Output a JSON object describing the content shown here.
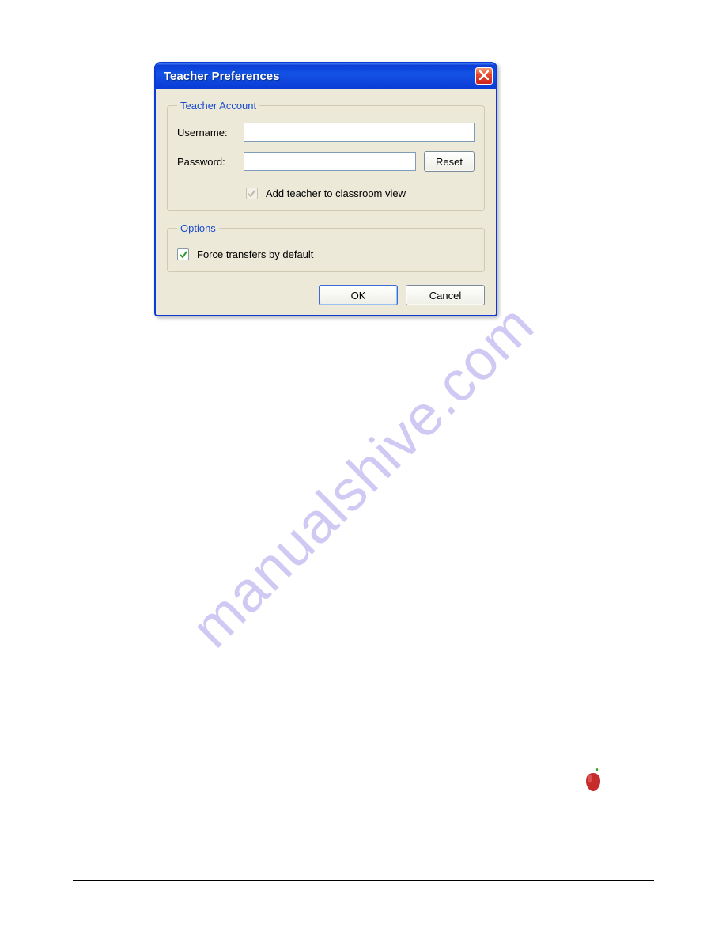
{
  "watermark": "manualshive.com",
  "dialog": {
    "title": "Teacher Preferences",
    "group_account": {
      "legend": "Teacher Account",
      "username_label": "Username:",
      "username_value": "",
      "password_label": "Password:",
      "password_value": "",
      "reset_label": "Reset",
      "add_teacher_label": "Add teacher to classroom view"
    },
    "group_options": {
      "legend": "Options",
      "force_transfers_label": "Force transfers by default"
    },
    "ok_label": "OK",
    "cancel_label": "Cancel"
  }
}
